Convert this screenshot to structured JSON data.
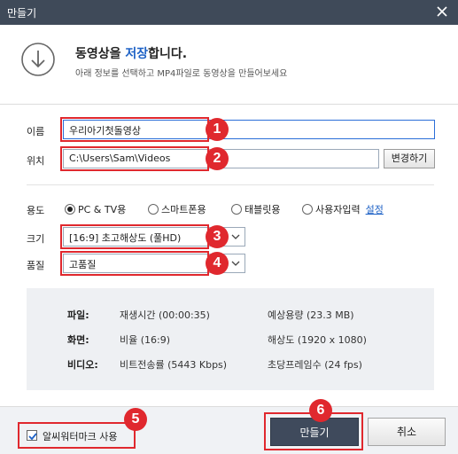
{
  "window": {
    "title": "만들기"
  },
  "header": {
    "title_part1": "동영상을 ",
    "title_accent": "저장",
    "title_part2": "합니다.",
    "subtitle": "아래 정보를 선택하고 MP4파일로 동영상을 만들어보세요"
  },
  "form": {
    "name_label": "이름",
    "name_value": "우리아기첫돌영상",
    "location_label": "위치",
    "location_value": "C:\\Users\\Sam\\Videos",
    "change_button": "변경하기",
    "usage_label": "용도",
    "usage_options": [
      {
        "label": "PC & TV용",
        "selected": true
      },
      {
        "label": "스마트폰용",
        "selected": false
      },
      {
        "label": "태블릿용",
        "selected": false
      },
      {
        "label": "사용자입력",
        "selected": false
      }
    ],
    "settings_link": "설정",
    "size_label": "크기",
    "size_value": "[16:9] 초고해상도 (풀HD)",
    "quality_label": "품질",
    "quality_value": "고품질"
  },
  "info": {
    "file_label": "파일:",
    "file_left": "재생시간 (00:00:35)",
    "file_right": "예상용량 (23.3 MB)",
    "screen_label": "화면:",
    "screen_left": "비율 (16:9)",
    "screen_right": "해상도 (1920 x 1080)",
    "video_label": "비디오:",
    "video_left": "비트전송률 (5443 Kbps)",
    "video_right": "초당프레임수 (24 fps)"
  },
  "footer": {
    "watermark_label": "알씨워터마크 사용",
    "watermark_checked": true,
    "make_button": "만들기",
    "cancel_button": "취소"
  },
  "annotations": [
    "1",
    "2",
    "3",
    "4",
    "5",
    "6"
  ],
  "colors": {
    "accent": "#1e62c6",
    "highlight": "#e0282e",
    "titlebar": "#3f4a59"
  }
}
